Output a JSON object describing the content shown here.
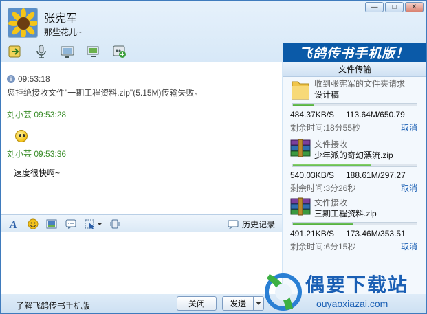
{
  "header": {
    "user_name": "张宪军",
    "signature": "那些花儿~"
  },
  "window_controls": {
    "minimize": "—",
    "maximize": "□",
    "close": "✕"
  },
  "toolbar": {
    "icons": [
      "file-transfer-icon",
      "voice-icon",
      "video-icon",
      "remote-desktop-icon",
      "apps-icon"
    ]
  },
  "banner": "飞鸽传书手机版！",
  "chat": {
    "system_time": "09:53:18",
    "system_message": "您拒绝接收文件\"一期工程资料.zip\"(5.15M)传输失败。",
    "messages": [
      {
        "sender": "刘小芸",
        "time": "09:53:28",
        "content_type": "emoticon",
        "text": ""
      },
      {
        "sender": "刘小芸",
        "time": "09:53:36",
        "content_type": "text",
        "text": "速度很快啊~"
      }
    ]
  },
  "format_bar": {
    "icons": [
      "font-icon",
      "emoticon-icon",
      "image-icon",
      "bubble-icon",
      "screenshot-icon",
      "shake-icon"
    ],
    "history_label": "历史记录"
  },
  "bottom": {
    "learn_link": "了解飞鸽传书手机版",
    "close_label": "关闭",
    "send_label": "发送"
  },
  "file_panel": {
    "title": "文件传输",
    "transfers": [
      {
        "title": "收到张宪军的文件夹请求",
        "name": "设计稿",
        "icon": "folder-icon",
        "speed": "484.37KB/S",
        "size": "113.64M/650.79",
        "remaining": "剩余时间:18分55秒",
        "progress": 0.17,
        "cancel": "取消"
      },
      {
        "title": "文件接收",
        "name": "少年派的奇幻漂流.zip",
        "icon": "archive-icon",
        "speed": "540.03KB/S",
        "size": "188.61M/297.27",
        "remaining": "剩余时间:3分26秒",
        "progress": 0.63,
        "cancel": "取消"
      },
      {
        "title": "文件接收",
        "name": "三期工程资料.zip",
        "icon": "archive-icon",
        "speed": "491.21KB/S",
        "size": "173.46M/353.51",
        "remaining": "剩余时间:6分15秒",
        "progress": 0.49,
        "cancel": "取消"
      }
    ]
  },
  "watermark": {
    "text": "偶要下载站",
    "url": "ouyaoxiazai.com"
  },
  "colors": {
    "accent": "#1a5fb4",
    "sender": "#3b8d2a",
    "progress": "#4eaa3a",
    "banner": "#0b5aa8"
  }
}
